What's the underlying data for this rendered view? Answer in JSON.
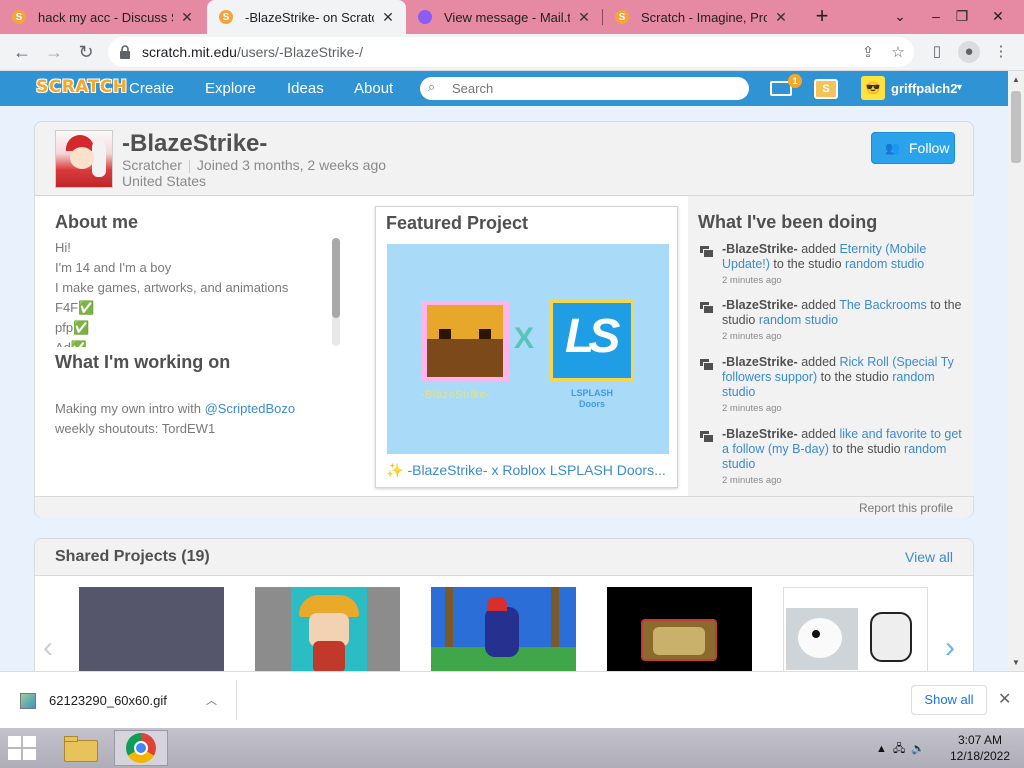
{
  "browser": {
    "tabs": [
      {
        "title": "hack my acc - Discuss Sc",
        "active": false,
        "favicon_color": "#f7a33b"
      },
      {
        "title": "-BlazeStrike- on Scratch",
        "active": true,
        "favicon_color": "#f7a33b"
      },
      {
        "title": "View message - Mail.tm",
        "active": false,
        "favicon_color": "#8b5cf6"
      },
      {
        "title": "Scratch - Imagine, Progr",
        "active": false,
        "favicon_color": "#f7a33b"
      }
    ],
    "url_host": "scratch.mit.edu",
    "url_path": "/users/-BlazeStrike-/"
  },
  "scratch_nav": {
    "logo": "SCRATCH",
    "links": [
      "Create",
      "Explore",
      "Ideas",
      "About"
    ],
    "search_placeholder": "Search",
    "messages_count": "1",
    "username": "griffpalch2"
  },
  "profile": {
    "username": "-BlazeStrike-",
    "role": "Scratcher",
    "joined": "Joined 3 months, 2 weeks ago",
    "location": "United States",
    "follow_label": "Follow",
    "about_heading": "About me",
    "about_lines": [
      "Hi!",
      "I'm 14 and I'm a boy",
      "I make games, artworks, and animations",
      "F4F✅",
      "pfp✅",
      "Ad✅"
    ],
    "working_heading": "What I'm working on",
    "working_prefix": "Making my own intro with ",
    "working_link": "@ScriptedBozo",
    "working_line2": "weekly shoutouts: TordEW1",
    "featured_heading": "Featured Project",
    "featured_title": "-BlazeStrike- x Roblox LSPLASH Doors...",
    "featured_thumb_text": {
      "left": "-BlazeStrike-",
      "x": "X",
      "logo": "LS",
      "right_1": "LSPLASH",
      "right_2": "Doors"
    },
    "activity_heading": "What I've been doing",
    "activity": [
      {
        "who": "-BlazeStrike-",
        "verb": " added ",
        "project": "Eternity (Mobile Update!)",
        "mid": " to the studio ",
        "studio": "random studio",
        "when": "2 minutes ago"
      },
      {
        "who": "-BlazeStrike-",
        "verb": " added ",
        "project": "The Backrooms",
        "mid": " to the studio ",
        "studio": "random studio",
        "when": "2 minutes ago"
      },
      {
        "who": "-BlazeStrike-",
        "verb": " added ",
        "project": "Rick Roll (Special Ty followers suppor)",
        "mid": " to the studio ",
        "studio": "random studio",
        "when": "2 minutes ago"
      },
      {
        "who": "-BlazeStrike-",
        "verb": " added ",
        "project": "like and favorite to get a follow (my B-day)",
        "mid": " to the studio ",
        "studio": "random studio",
        "when": "2 minutes ago"
      }
    ],
    "report_label": "Report this profile"
  },
  "shared_projects": {
    "title": "Shared Projects (19)",
    "view_all": "View all"
  },
  "downloads": {
    "filename": "62123290_60x60.gif",
    "show_all": "Show all"
  },
  "taskbar": {
    "time": "3:07 AM",
    "date": "12/18/2022"
  },
  "colors": {
    "scratch_blue": "#2f93d4",
    "link": "#3b8bd0",
    "follow": "#2aa3ea",
    "tabstrip": "#e68aa3"
  }
}
